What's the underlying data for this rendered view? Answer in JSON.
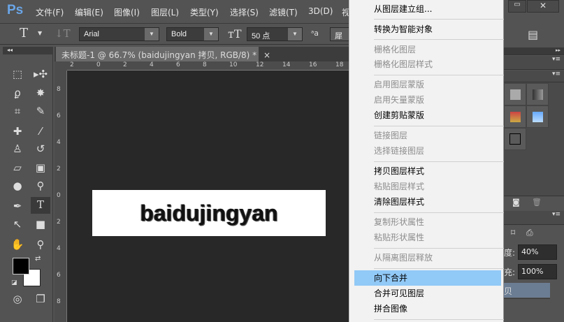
{
  "app": {
    "logo": "Ps"
  },
  "menubar": [
    "文件(F)",
    "编辑(E)",
    "图像(I)",
    "图层(L)",
    "类型(Y)",
    "选择(S)",
    "滤镜(T)",
    "3D(D)",
    "视"
  ],
  "options": {
    "font_family": "Arial",
    "font_style": "Bold",
    "font_size": "50 点",
    "antialias": "犀利"
  },
  "document": {
    "tab_title": "未标题-1 @ 66.7% (baidujingyan 拷贝, RGB/8) *",
    "close": "×",
    "canvas_text": "baidujingyan"
  },
  "rulers": {
    "h": [
      "2",
      "0",
      "2",
      "4",
      "6",
      "8",
      "10",
      "12",
      "14",
      "16",
      "18"
    ],
    "v": [
      "8",
      "6",
      "4",
      "2",
      "0",
      "2",
      "4",
      "6",
      "8"
    ]
  },
  "context_menu": [
    {
      "label": "从图层建立组...",
      "enabled": true
    },
    {
      "label": "转换为智能对象",
      "enabled": true
    },
    {
      "label": "栅格化图层",
      "enabled": false
    },
    {
      "label": "栅格化图层样式",
      "enabled": false
    },
    {
      "label": "启用图层蒙版",
      "enabled": false
    },
    {
      "label": "启用矢量蒙版",
      "enabled": false
    },
    {
      "label": "创建剪贴蒙版",
      "enabled": true
    },
    {
      "label": "链接图层",
      "enabled": false
    },
    {
      "label": "选择链接图层",
      "enabled": false
    },
    {
      "label": "拷贝图层样式",
      "enabled": true
    },
    {
      "label": "粘贴图层样式",
      "enabled": false
    },
    {
      "label": "清除图层样式",
      "enabled": true
    },
    {
      "label": "复制形状属性",
      "enabled": false
    },
    {
      "label": "粘贴形状属性",
      "enabled": false
    },
    {
      "label": "从隔离图层释放",
      "enabled": false
    },
    {
      "label": "向下合并",
      "enabled": true,
      "highlighted": true
    },
    {
      "label": "合并可见图层",
      "enabled": true
    },
    {
      "label": "拼合图像",
      "enabled": true
    }
  ],
  "layers_panel": {
    "opacity_label": "度:",
    "opacity": "40%",
    "fill_label": "充:",
    "fill": "100%",
    "layer_name_partial": "贝"
  },
  "colors": {
    "highlight": "#91c9f7",
    "canvas_bg": "#282828",
    "ui": "#535353"
  }
}
